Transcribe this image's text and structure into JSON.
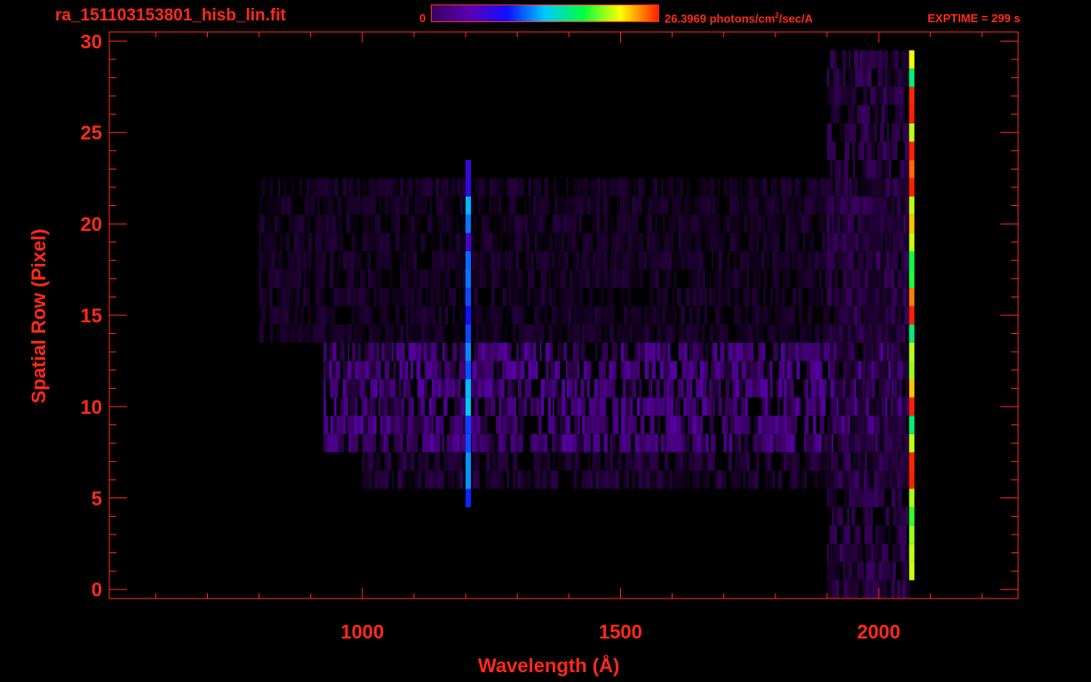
{
  "header": {
    "file_title": "ra_151103153801_hisb_lin.fit",
    "colorbar_min": "0",
    "colorbar_max_prefix": "26.3969 photons/cm",
    "colorbar_max_sup": "2",
    "colorbar_max_suffix": "/sec/A",
    "exptime": "EXPTIME = 299 s"
  },
  "colors": {
    "axis": "#ff2a1a",
    "background": "#000000",
    "colormap": [
      "#000000",
      "#3a0060",
      "#5a00b0",
      "#1010ff",
      "#00c8ff",
      "#00ff40",
      "#ffff00",
      "#ff2000"
    ]
  },
  "chart_data": {
    "type": "heatmap",
    "xlabel": "Wavelength (Å)",
    "ylabel": "Spatial Row (Pixel)",
    "x_ticks": [
      1000,
      1500,
      2000
    ],
    "y_ticks": [
      0,
      5,
      10,
      15,
      20,
      25,
      30
    ],
    "xlim": [
      510,
      2270
    ],
    "ylim": [
      -0.5,
      30.5
    ],
    "colorbar_range": [
      0,
      26.3969
    ],
    "features": [
      {
        "kind": "band",
        "x_range": [
          925,
          2060
        ],
        "y_range": [
          8,
          14
        ],
        "level": 0.18
      },
      {
        "kind": "band",
        "x_range": [
          1000,
          2060
        ],
        "y_range": [
          6,
          8
        ],
        "level": 0.08
      },
      {
        "kind": "band",
        "x_range": [
          800,
          2060
        ],
        "y_range": [
          14,
          23
        ],
        "level": 0.06
      },
      {
        "kind": "band",
        "x_range": [
          1900,
          2060
        ],
        "y_range": [
          0,
          30
        ],
        "level": 0.1
      },
      {
        "kind": "line",
        "x": 1205,
        "y_range": [
          5,
          24
        ],
        "level": 0.45
      },
      {
        "kind": "line",
        "x": 2064,
        "y_range": [
          1,
          30
        ],
        "level": 0.85
      }
    ]
  }
}
